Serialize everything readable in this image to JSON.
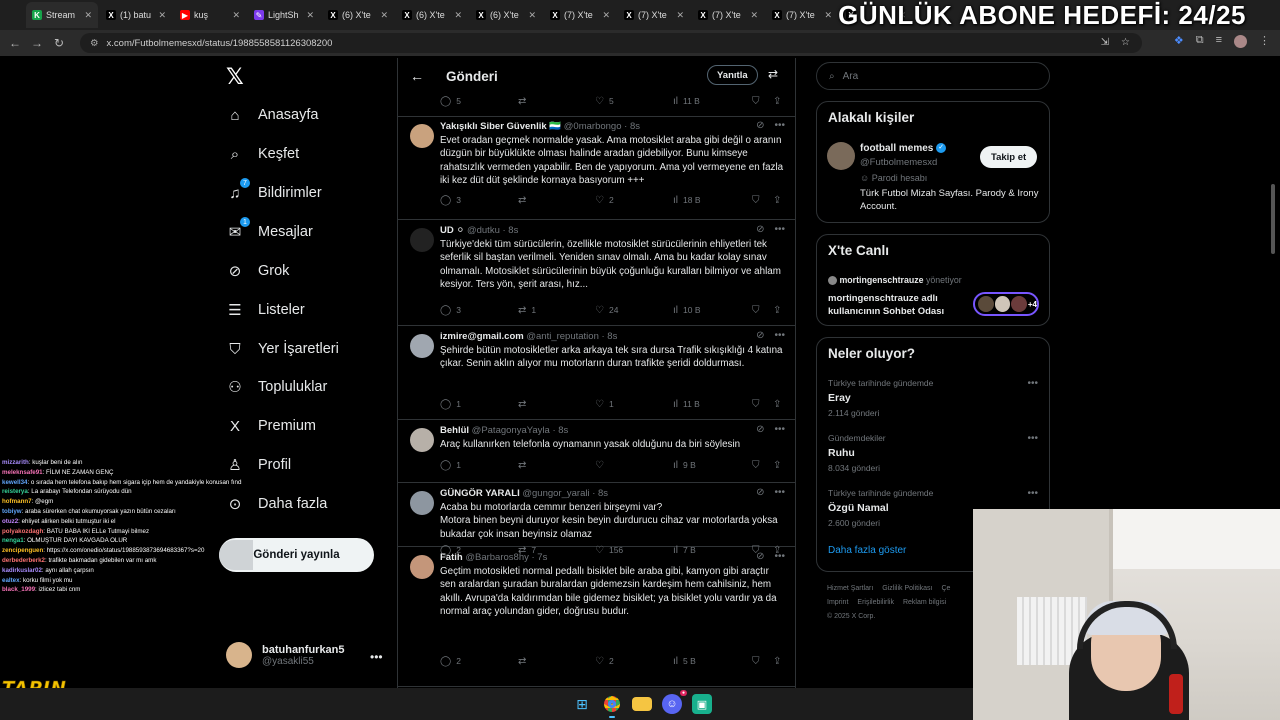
{
  "browser": {
    "tabs": [
      {
        "label": "Stream",
        "color": "#16a34a",
        "glyph": "K"
      },
      {
        "label": "(1) batu",
        "color": "#000000",
        "glyph": "X"
      },
      {
        "label": "kuş",
        "color": "#ff0000",
        "glyph": "▶"
      },
      {
        "label": "LightSh",
        "color": "#7c3aed",
        "glyph": "✎"
      },
      {
        "label": "(6) X'te",
        "color": "#000000",
        "glyph": "X"
      },
      {
        "label": "(6) X'te",
        "color": "#000000",
        "glyph": "X"
      },
      {
        "label": "(6) X'te",
        "color": "#000000",
        "glyph": "X"
      },
      {
        "label": "(7) X'te",
        "color": "#000000",
        "glyph": "X"
      },
      {
        "label": "(7) X'te",
        "color": "#000000",
        "glyph": "X"
      },
      {
        "label": "(7) X'te",
        "color": "#000000",
        "glyph": "X"
      },
      {
        "label": "(7) X'te",
        "color": "#000000",
        "glyph": "X"
      },
      {
        "label": "",
        "color": "#000000",
        "glyph": "X"
      }
    ],
    "url": "x.com/Futbolmemesxd/status/1988558581126308200"
  },
  "overlay": {
    "goal_text": "GÜNLÜK ABONE HEDEFİ: 24/25",
    "chat": [
      {
        "user": "mizzarith",
        "color": "#a78bfa",
        "msg": ": kuşlar beni de alın"
      },
      {
        "user": "meleknsafe91",
        "color": "#f472b6",
        "msg": ": FİLM NE ZAMAN GENÇ"
      },
      {
        "user": "kewell34",
        "color": "#60a5fa",
        "msg": ": o sırada hem telefona bakıp hem sigara içip hem de yandakiyle konusan fındık"
      },
      {
        "user": "reisterya",
        "color": "#34d399",
        "msg": ": La arabayı Telefondan sürüyodu dün"
      },
      {
        "user": "hofmann7",
        "color": "#fbbf24",
        "msg": ": @egm"
      },
      {
        "user": "tobiyw",
        "color": "#60a5fa",
        "msg": ": araba sürerken chat okumuyorsak yazın bütün cezaları"
      },
      {
        "user": "otuz2",
        "color": "#c084fc",
        "msg": ": ehliyet alirken belki tutmuştur iki el"
      },
      {
        "user": "polyakozdagh",
        "color": "#f87171",
        "msg": ": BATU BABA IKI ELLe Tutmayi bilmez"
      },
      {
        "user": "nenga1",
        "color": "#34d399",
        "msg": ": OLMUŞTUR DAYI KAVGADA OLUR"
      },
      {
        "user": "zencipenguen",
        "color": "#fbbf24",
        "msg": ": https://x.com/onedio/status/1988593873694683367?s=20"
      },
      {
        "user": "derbederberk2",
        "color": "#f87171",
        "msg": ": trafikte bakmadan gidebilen var mı amk"
      },
      {
        "user": "kadirkuslar02",
        "color": "#a78bfa",
        "msg": ": aynı allah çarpsın"
      },
      {
        "user": "ealtex",
        "color": "#60a5fa",
        "msg": ": korku filmi yok mu"
      },
      {
        "user": "black_1999",
        "color": "#f472b6",
        "msg": ": izlicez tabi cnm"
      }
    ],
    "brand_logo": "TAPIN"
  },
  "leftnav": {
    "items": [
      {
        "label": "Anasayfa",
        "icon": "home-icon",
        "glyph": "⌂",
        "badge": ""
      },
      {
        "label": "Keşfet",
        "icon": "search-icon",
        "glyph": "⌕",
        "badge": ""
      },
      {
        "label": "Bildirimler",
        "icon": "bell-icon",
        "glyph": "♫",
        "badge": "7"
      },
      {
        "label": "Mesajlar",
        "icon": "mail-icon",
        "glyph": "✉",
        "badge": "1"
      },
      {
        "label": "Grok",
        "icon": "grok-icon",
        "glyph": "⊘",
        "badge": ""
      },
      {
        "label": "Listeler",
        "icon": "list-icon",
        "glyph": "☰",
        "badge": ""
      },
      {
        "label": "Yer İşaretleri",
        "icon": "bookmark-icon",
        "glyph": "⛉",
        "badge": ""
      },
      {
        "label": "Topluluklar",
        "icon": "communities-icon",
        "glyph": "⚇",
        "badge": ""
      },
      {
        "label": "Premium",
        "icon": "x-premium-icon",
        "glyph": "X",
        "badge": ""
      },
      {
        "label": "Profil",
        "icon": "profile-icon",
        "glyph": "♙",
        "badge": ""
      },
      {
        "label": "Daha fazla",
        "icon": "more-circle-icon",
        "glyph": "⊙",
        "badge": ""
      }
    ],
    "post_button": "Gönderi yayınla",
    "account": {
      "name": "batuhanfurkan5",
      "handle": "@yasakli55"
    }
  },
  "timeline": {
    "header_title": "Gönderi",
    "reply_button": "Yanıtla",
    "top_actions": {
      "replies": "5",
      "reposts": "",
      "likes": "5",
      "views": "11 B"
    },
    "posts": [
      {
        "name": "Yakışıklı Siber Güvenlik 🇸🇱",
        "handle": "@0marbongo",
        "time": "· 8s",
        "text": "Evet oradan geçmek normalde yasak. Ama motosiklet araba gibi değil o aranın düzgün bir büyüklükte olması halinde aradan gidebiliyor. Bunu kimseye rahatsızlık vermeden yapabilir. Ben de yapıyorum. Ama yol vermeyene en fazla iki kez düt düt şeklinde kornaya basıyorum +++",
        "replies": "3",
        "reposts": "",
        "likes": "2",
        "views": "18 B",
        "avatar_color": "#c9a27e"
      },
      {
        "name": "UD ⚪",
        "handle": "@dutku",
        "time": "· 8s",
        "text": "Türkiye'deki tüm sürücülerin, özellikle motosiklet sürücülerinin ehliyetleri tek seferlik sil baştan verilmeli. Yeniden sınav olmalı. Ama bu kadar kolay sınav olmamalı. Motosiklet sürücülerinin büyük çoğunluğu kuralları bilmiyor ve ahlam kesiyor. Ters yön, şerit arası, hız...",
        "replies": "3",
        "reposts": "1",
        "likes": "24",
        "views": "10 B",
        "avatar_color": "#222222"
      },
      {
        "name": "izmire@gmail.com",
        "handle": "@anti_reputation",
        "time": "· 8s",
        "text": "Şehirde bütün motosikletler arka arkaya tek sıra dursa Trafik sıkışıklığı 4 katına çıkar.  Senin aklın alıyor mu motorların duran trafikte şeridi doldurması.",
        "replies": "1",
        "reposts": "",
        "likes": "1",
        "views": "11 B",
        "avatar_color": "#a0a7b0"
      },
      {
        "name": "Behlül",
        "handle": "@PatagonyaYayla",
        "time": "· 8s",
        "text": "Araç kullanırken telefonla oynamanın yasak olduğunu da biri söylesin",
        "replies": "1",
        "reposts": "",
        "likes": "",
        "views": "9 B",
        "avatar_color": "#b7b0a8"
      },
      {
        "name": "GÜNGÖR YARALI",
        "handle": "@gungor_yarali",
        "time": "· 8s",
        "text": "Acaba bu motorlarda cemmır benzeri birşeymi var?\nMotora binen beyni duruyor kesin beyin durdurucu cihaz var motorlarda yoksa bukadar çok insan beyinsiz olamaz",
        "replies": "2",
        "reposts": "7",
        "likes": "156",
        "views": "7 B",
        "avatar_color": "#8d96a0"
      },
      {
        "name": "Fatih",
        "handle": "@Barbaros8hy",
        "time": "· 7s",
        "text": "Geçtim motosikleti normal pedallı bisiklet bile araba gibi, kamyon gibi araçtır sen aralardan şuradan buralardan gidemezsin kardeşim hem cahilsiniz, hem akıllı. Avrupa'da kaldırımdan bile gidemez bisiklet; ya bisiklet yolu vardır ya da normal araç yolundan gider, doğrusu budur.",
        "replies": "2",
        "reposts": "",
        "likes": "2",
        "views": "5 B",
        "avatar_color": "#c4967a"
      }
    ]
  },
  "right": {
    "search_placeholder": "Ara",
    "related": {
      "title": "Alakalı kişiler",
      "name": "football memes",
      "handle": "@Futbolmemesxd",
      "label": "Parodi hesabı",
      "bio": "Türk Futbol Mizah Sayfası. Parody & Irony Account.",
      "follow": "Takip et"
    },
    "live": {
      "title": "X'te Canlı",
      "host": "mortingenschtrauze",
      "host_suffix": "yönetiyor",
      "room": "mortingenschtrauze adlı kullanıcının Sohbet Odası",
      "more": "+4"
    },
    "trends": {
      "title": "Neler oluyor?",
      "items": [
        {
          "context": "Türkiye tarihinde gündemde",
          "name": "Eray",
          "count": "2.114 gönderi"
        },
        {
          "context": "Gündemdekiler",
          "name": "Ruhu",
          "count": "8.034 gönderi"
        },
        {
          "context": "Türkiye tarihinde gündemde",
          "name": "Özgü Namal",
          "count": "2.600 gönderi"
        }
      ],
      "show_more": "Daha fazla göster"
    },
    "footer": [
      "Hizmet Şartları",
      "Gizlilik Politikası",
      "Çe",
      "Imprint",
      "Erişilebilirlik",
      "Reklam bilgisi",
      "© 2025 X Corp."
    ]
  },
  "colors": {
    "accent": "#1d9bf0",
    "background": "#000000",
    "border": "#2f3336",
    "muted": "#71767b"
  }
}
